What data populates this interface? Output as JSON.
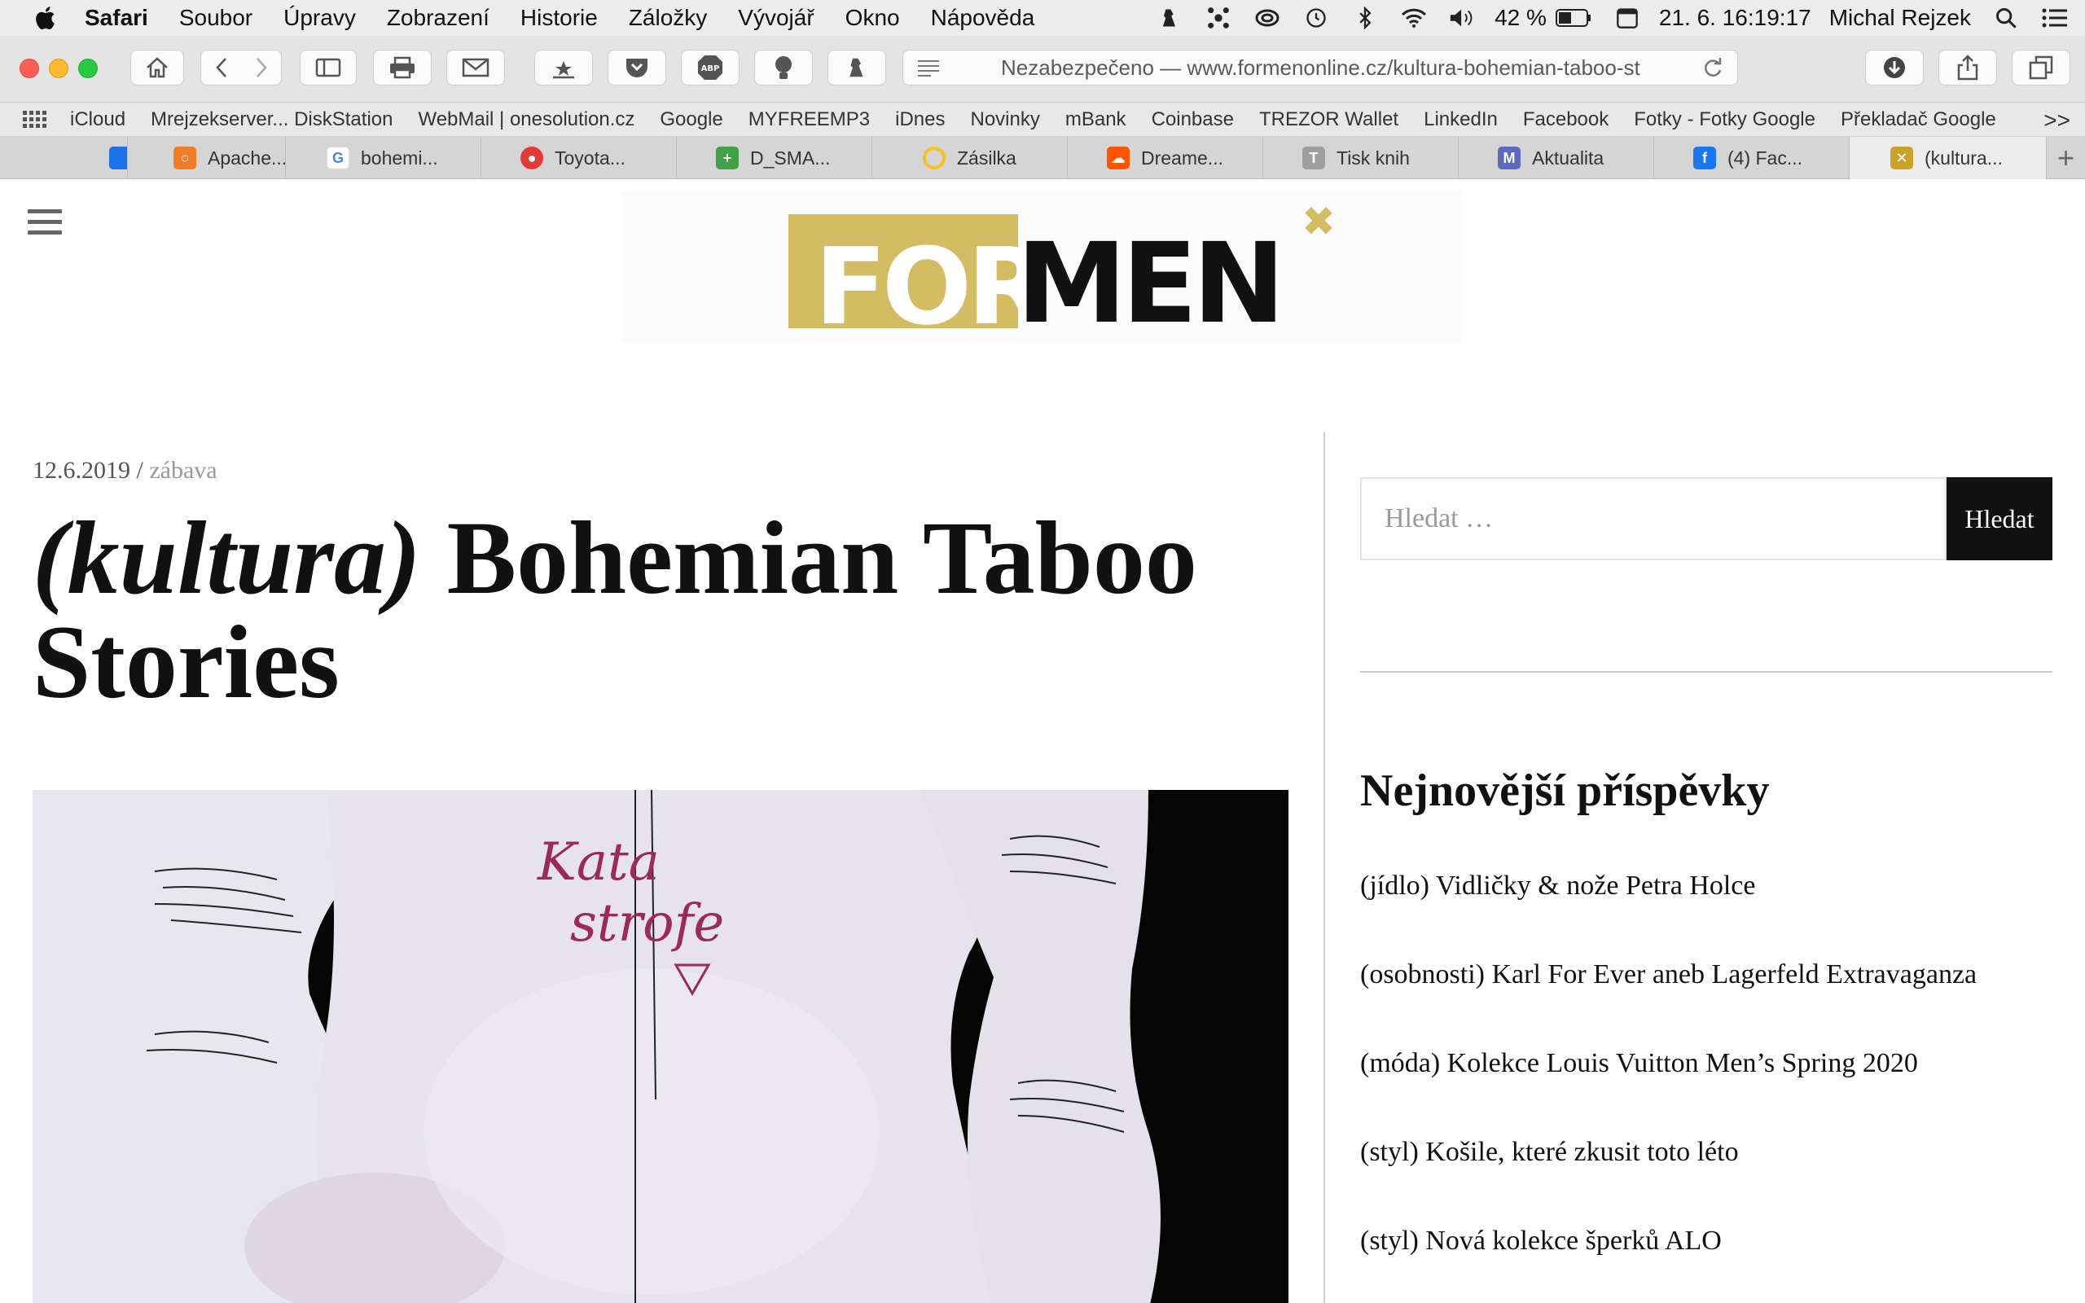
{
  "menubar": {
    "app": "Safari",
    "items": [
      "Soubor",
      "Úpravy",
      "Zobrazení",
      "Historie",
      "Záložky",
      "Vývojář",
      "Okno",
      "Nápověda"
    ],
    "battery": "42 %",
    "datetime": "21. 6.  16:19:17",
    "user": "Michal Rejzek"
  },
  "toolbar": {
    "url_text": "Nezabezpečeno — www.formenonline.cz/kultura-bohemian-taboo-st"
  },
  "bookmarks": [
    "iCloud",
    "Mrejzekserver... DiskStation",
    "WebMail | onesolution.cz",
    "Google",
    "MYFREEMP3",
    "iDnes",
    "Novinky",
    "mBank",
    "Coinbase",
    "TREZOR Wallet",
    "LinkedIn",
    "Facebook",
    "Fotky - Fotky Google",
    "Překladač Google"
  ],
  "bookmarks_more": ">>",
  "tabs": [
    {
      "label": "",
      "color": "#1a73e8"
    },
    {
      "label": "Apache...",
      "color": "#f07b28"
    },
    {
      "label": "bohemi...",
      "color": "#4285f4"
    },
    {
      "label": "Toyota...",
      "color": "#e53935"
    },
    {
      "label": "D_SMA...",
      "color": "#43a047"
    },
    {
      "label": "Zásilka",
      "color": "#f6c21c"
    },
    {
      "label": "Dreame...",
      "color": "#ff5500"
    },
    {
      "label": "Tisk knih",
      "color": "#9e9e9e"
    },
    {
      "label": "Aktualita",
      "color": "#5c6bc0"
    },
    {
      "label": "(4) Fac...",
      "color": "#1877f2"
    },
    {
      "label": "(kultura...",
      "color": "#c9a227"
    }
  ],
  "colors": {
    "logo_gold": "#d4bc63",
    "button_dark": "#111111"
  },
  "site": {
    "logo_for": "FOR",
    "logo_men": "MEN"
  },
  "article": {
    "date": "12.6.2019",
    "separator": " / ",
    "category": "zábava",
    "title_tag": "(kultura)",
    "title_rest": " Bohemian Taboo Stories",
    "hero_text_1": "Kata",
    "hero_text_2": "strofe"
  },
  "sidebar": {
    "search_placeholder": "Hledat …",
    "search_button": "Hledat",
    "recent_title": "Nejnovější příspěvky",
    "recent": [
      "(jídlo) Vidličky & nože Petra Holce",
      "(osobnosti) Karl For Ever aneb Lagerfeld Extravaganza",
      "(móda) Kolekce Louis Vuitton Men’s Spring 2020",
      "(styl) Košile, které zkusit toto léto",
      "(styl) Nová kolekce šperků ALO"
    ]
  }
}
